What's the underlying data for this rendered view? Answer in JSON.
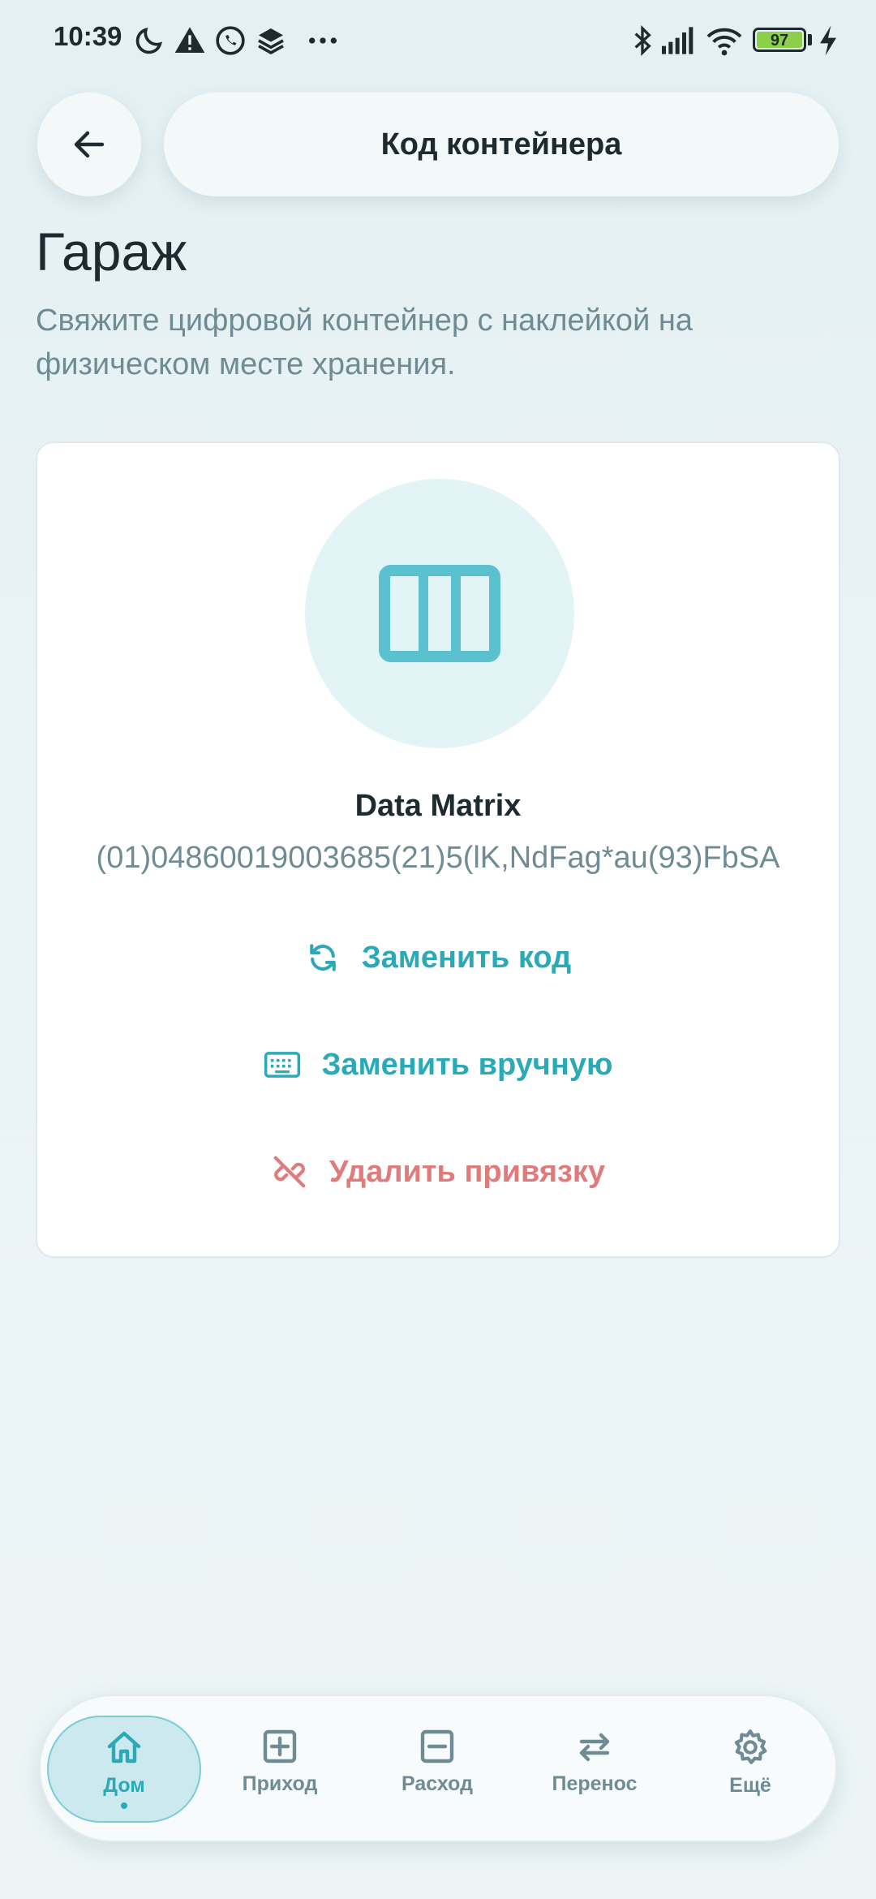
{
  "status_bar": {
    "time": "10:39",
    "battery": "97",
    "icons": [
      "moon-icon",
      "warning-icon",
      "whatsapp-icon",
      "stack-icon",
      "more-icon",
      "bluetooth-icon",
      "signal-icon",
      "wifi-icon",
      "battery-icon",
      "charging-icon"
    ]
  },
  "header": {
    "title": "Код контейнера",
    "back_icon": "arrow-left-icon"
  },
  "page": {
    "title": "Гараж",
    "description": "Свяжите цифровой контейнер с наклейкой на физическом месте хранения."
  },
  "card": {
    "icon": "shelf-icon",
    "code_type": "Data Matrix",
    "code_value": "(01)04860019003685(21)5(lK,NdFag*au(93)FbSA",
    "actions": [
      {
        "label": "Заменить код",
        "icon": "refresh-icon"
      },
      {
        "label": "Заменить вручную",
        "icon": "keyboard-icon"
      },
      {
        "label": "Удалить привязку",
        "icon": "unlink-icon"
      }
    ]
  },
  "nav": {
    "items": [
      {
        "label": "Дом",
        "icon": "home-icon",
        "active": true
      },
      {
        "label": "Приход",
        "icon": "plus-square-icon"
      },
      {
        "label": "Расход",
        "icon": "minus-square-icon"
      },
      {
        "label": "Перенос",
        "icon": "transfer-icon"
      },
      {
        "label": "Ещё",
        "icon": "gear-icon"
      }
    ]
  },
  "colors": {
    "accent": "#2ba9b7",
    "danger": "#e07b7b",
    "muted_text": "#6f8b93",
    "background": "#eaf3f6"
  }
}
